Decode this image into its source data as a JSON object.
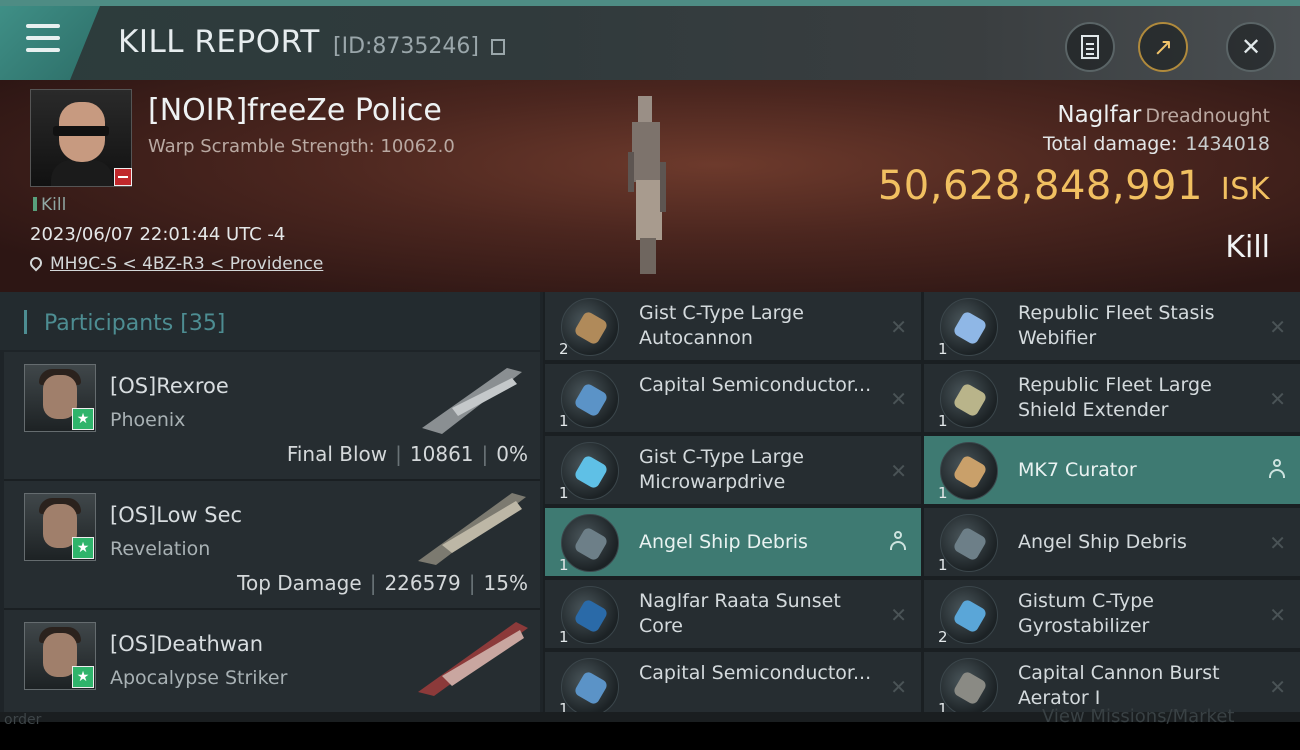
{
  "header": {
    "title": "KILL REPORT",
    "kill_id": "[ID:8735246]"
  },
  "victim": {
    "name": "[NOIR]freeZe Police",
    "scramble": "Warp Scramble Strength: 10062.0",
    "kill_tag": "Kill",
    "timestamp": "2023/06/07 22:01:44 UTC -4",
    "location": "MH9C-S < 4BZ-R3 < Providence",
    "ship": "Naglfar",
    "ship_class": "Dreadnought",
    "total_damage_label": "Total damage:",
    "total_damage": "1434018",
    "isk_value": "50,628,848,991",
    "isk_unit": "ISK",
    "result": "Kill"
  },
  "participants": {
    "title": "Participants",
    "count": "[35]",
    "rows": [
      {
        "name": "[OS]Rexroe",
        "ship": "Phoenix",
        "stat_label": "Final Blow",
        "damage": "10861",
        "percent": "0%"
      },
      {
        "name": "[OS]Low Sec",
        "ship": "Revelation",
        "stat_label": "Top Damage",
        "damage": "226579",
        "percent": "15%"
      },
      {
        "name": "[OS]Deathwan",
        "ship": "Apocalypse Striker"
      }
    ]
  },
  "modules_left": [
    {
      "name": "Gist C-Type Large Autocannon",
      "qty": "2",
      "color": "#b08a5a"
    },
    {
      "name": "Capital Semiconductor...",
      "qty": "1",
      "color": "#5b93c7"
    },
    {
      "name": "Gist C-Type Large Microwarpdrive",
      "qty": "1",
      "color": "#5fc0e6"
    },
    {
      "name": "Angel Ship Debris",
      "qty": "1",
      "color": "#6d7f88",
      "highlight": true
    },
    {
      "name": "Naglfar Raata Sunset Core",
      "qty": "1",
      "color": "#2a6aa8"
    },
    {
      "name": "Capital Semiconductor...",
      "qty": "1",
      "color": "#5b93c7"
    }
  ],
  "modules_right": [
    {
      "name": "Republic Fleet Stasis Webifier",
      "qty": "1",
      "color": "#8fb7e6"
    },
    {
      "name": "Republic Fleet Large Shield Extender",
      "qty": "1",
      "color": "#b9b48a"
    },
    {
      "name": "MK7 Curator",
      "qty": "1",
      "color": "#c9a06a",
      "highlight": true
    },
    {
      "name": "Angel Ship Debris",
      "qty": "1",
      "color": "#6d7f88"
    },
    {
      "name": "Gistum C-Type Gyrostabilizer",
      "qty": "2",
      "color": "#5aa6d8"
    },
    {
      "name": "Capital Cannon Burst Aerator I",
      "qty": "1",
      "color": "#8a8a84"
    }
  ],
  "ghost": {
    "order": "order",
    "missions": "View Missions/Market"
  },
  "colors": {
    "accent_teal": "#3e7a72",
    "isk_gold": "#f1c061",
    "star_green": "#2fb46b",
    "minus_red": "#c0282c"
  }
}
